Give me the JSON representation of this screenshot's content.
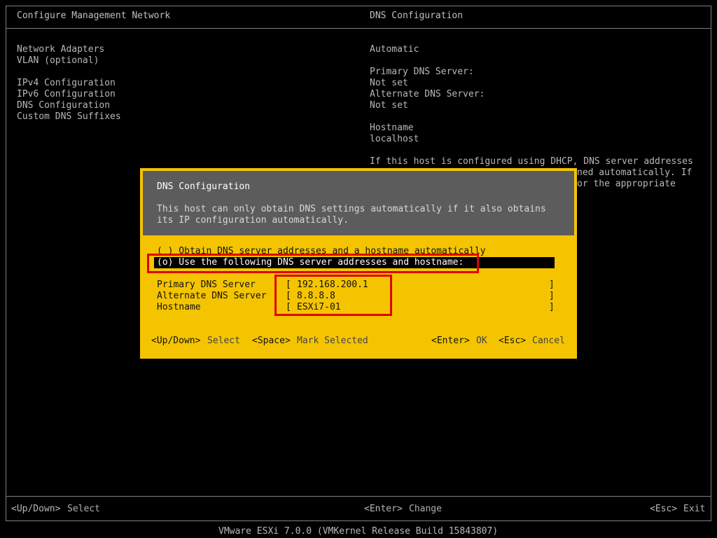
{
  "left_panel": {
    "title": "Configure Management Network",
    "menu": [
      "Network Adapters",
      "VLAN (optional)",
      "IPv4 Configuration",
      "IPv6 Configuration",
      "DNS Configuration",
      "Custom DNS Suffixes"
    ]
  },
  "right_panel": {
    "title": "DNS Configuration",
    "mode": "Automatic",
    "primary_label": "Primary DNS Server:",
    "primary_value": "Not set",
    "alternate_label": "Alternate DNS Server:",
    "alternate_value": "Not set",
    "hostname_label": "Hostname",
    "hostname_value": "localhost",
    "info_line1": "If this host is configured using DHCP, DNS server addresses",
    "info_line2_visible": "ned automatically. If",
    "info_line3_visible": "or the appropriate"
  },
  "dialog": {
    "title": "DNS Configuration",
    "message_line1": "This host can only obtain DNS settings automatically if it also obtains",
    "message_line2": "its IP configuration automatically.",
    "option_auto": "( ) Obtain DNS server addresses and a hostname automatically",
    "option_manual": "(o) Use the following DNS server addresses and hostname:",
    "fields": {
      "primary_label": "Primary DNS Server",
      "primary_value": "192.168.200.1",
      "alternate_label": "Alternate DNS Server",
      "alternate_value": "8.8.8.8",
      "hostname_label": "Hostname",
      "hostname_value": "ESXi7-01"
    },
    "keys": {
      "updown_key": "<Up/Down>",
      "updown_action": "Select",
      "space_key": "<Space>",
      "space_action": "Mark Selected",
      "enter_key": "<Enter>",
      "enter_action": "OK",
      "esc_key": "<Esc>",
      "esc_action": "Cancel"
    }
  },
  "footer": {
    "left_key": "<Up/Down>",
    "left_action": "Select",
    "center_key": "<Enter>",
    "center_action": "Change",
    "right_key": "<Esc>",
    "right_action": "Exit",
    "build": "VMware ESXi 7.0.0 (VMKernel Release Build 15843807)"
  },
  "colors": {
    "dialog_bg": "#f5c400",
    "dialog_header_bg": "#5c5c5c",
    "highlight": "#e00000"
  }
}
